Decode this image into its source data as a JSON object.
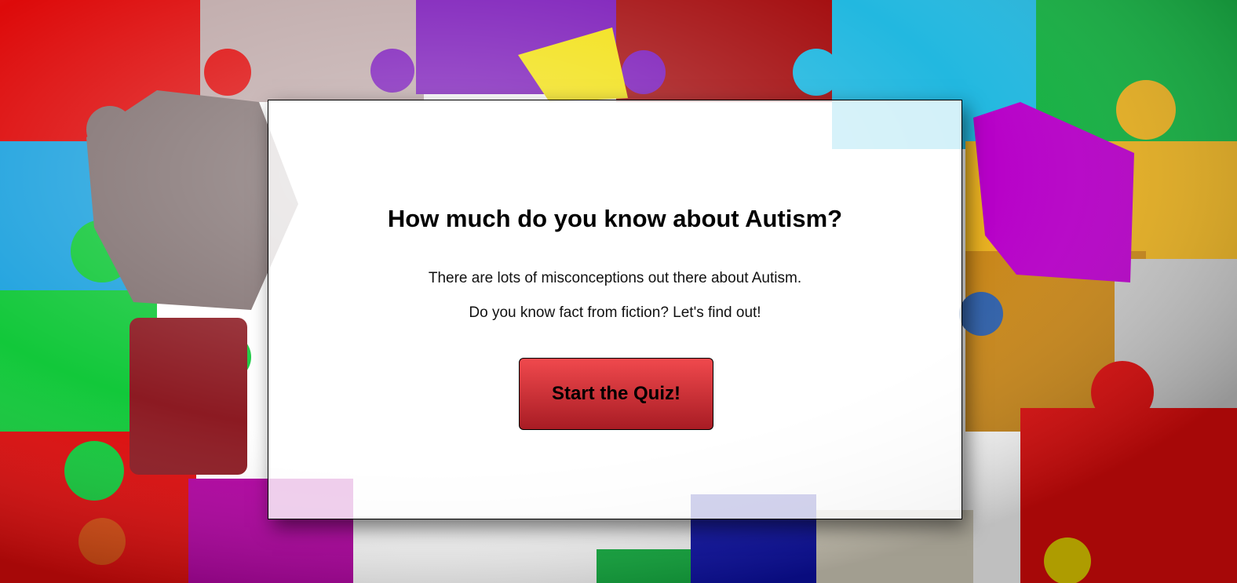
{
  "quiz_intro": {
    "title": "How much do you know about Autism?",
    "line1": "There are lots of misconceptions out there about Autism.",
    "line2": "Do you know fact from fiction? Let's find out!",
    "start_button_label": "Start the Quiz!"
  },
  "colors": {
    "button_gradient_top": "#f0494d",
    "button_gradient_bottom": "#a81c24",
    "card_background": "rgba(255,255,255,0.80)"
  },
  "background": {
    "image": "puzzle-pieces"
  }
}
